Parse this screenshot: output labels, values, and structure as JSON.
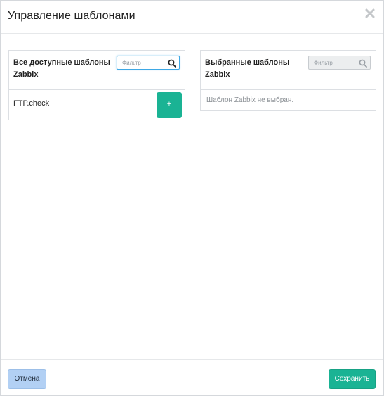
{
  "dialog": {
    "title": "Управление шаблонами",
    "close_icon": "close-icon"
  },
  "available": {
    "title": "Все доступные шаблоны Zabbix",
    "filter_placeholder": "Фильтр",
    "filter_value": "",
    "filter_icon": "search-icon",
    "items": [
      {
        "label": "FTP.check",
        "action_label": "+"
      }
    ]
  },
  "selected": {
    "title": "Выбранные шаблоны Zabbix",
    "filter_placeholder": "Фильтр",
    "filter_value": "",
    "filter_icon": "search-icon",
    "empty_text": "Шаблон Zabbix не выбран."
  },
  "footer": {
    "cancel_label": "Отмена",
    "save_label": "Сохранить"
  },
  "colors": {
    "accent_green": "#1ab394",
    "cancel_blue": "#b2d0f4",
    "focus_blue": "#3ea8e5"
  }
}
